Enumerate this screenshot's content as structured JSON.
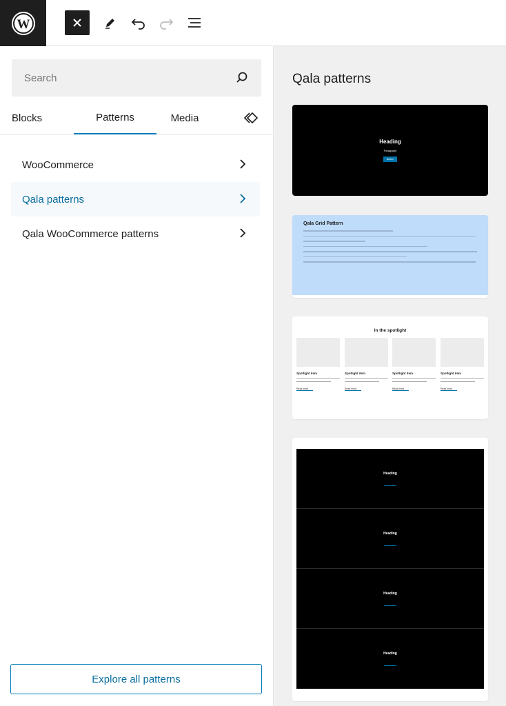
{
  "toolbar": {
    "logo": "wordpress-logo",
    "close_icon": "close-icon",
    "edit_icon": "pencil-icon",
    "undo_icon": "undo-icon",
    "redo_icon": "redo-icon",
    "list_icon": "document-overview-icon"
  },
  "sidebar": {
    "search_placeholder": "Search",
    "tabs": [
      {
        "label": "Blocks"
      },
      {
        "label": "Patterns",
        "active": true
      },
      {
        "label": "Media"
      },
      {
        "label": "",
        "icon": "synced-patterns-icon"
      }
    ],
    "categories": [
      {
        "label": "WooCommerce"
      },
      {
        "label": "Qala patterns",
        "active": true
      },
      {
        "label": "Qala WooCommerce patterns"
      }
    ],
    "explore_label": "Explore all patterns"
  },
  "preview": {
    "title": "Qala patterns",
    "hero": {
      "heading": "Heading",
      "paragraph": "Paragraph",
      "button": "Button"
    },
    "grid": {
      "title": "Qala Grid Pattern"
    },
    "spotlight": {
      "title": "In the spotlight",
      "items": [
        {
          "title": "Spotlight item",
          "link": "Read more"
        },
        {
          "title": "Spotlight item",
          "link": "Read more"
        },
        {
          "title": "Spotlight item",
          "link": "Read more"
        },
        {
          "title": "Spotlight item",
          "link": "Read more"
        }
      ]
    },
    "stack": {
      "headings": [
        "Heading",
        "Heading",
        "Heading",
        "Heading"
      ]
    }
  },
  "colors": {
    "accent": "#007cba",
    "active_text": "#0a6ea0",
    "dark": "#1e1e1e",
    "grid_bg": "#bfdcfb"
  }
}
